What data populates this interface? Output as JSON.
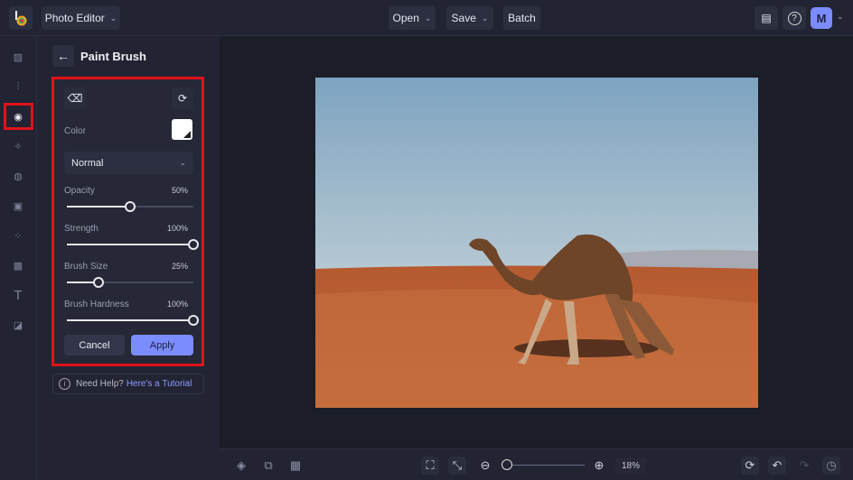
{
  "topbar": {
    "app_menu": "Photo Editor",
    "open": "Open",
    "save": "Save",
    "batch": "Batch",
    "avatar": "M"
  },
  "rail": {
    "icons": [
      "image-icon",
      "adjust-icon",
      "eye-icon",
      "effects-icon",
      "artsy-icon",
      "frames-icon",
      "graphics-icon",
      "texture-icon",
      "text-icon",
      "overlay-icon"
    ],
    "active": "eye-icon"
  },
  "panel": {
    "title": "Paint Brush",
    "color_label": "Color",
    "color_value": "#ffffff",
    "blend_mode": "Normal",
    "sliders": [
      {
        "label": "Opacity",
        "value": 50,
        "display": "50%"
      },
      {
        "label": "Strength",
        "value": 100,
        "display": "100%"
      },
      {
        "label": "Brush Size",
        "value": 25,
        "display": "25%"
      },
      {
        "label": "Brush Hardness",
        "value": 100,
        "display": "100%"
      }
    ],
    "cancel": "Cancel",
    "apply": "Apply",
    "help_text": "Need Help?",
    "help_link": "Here's a Tutorial"
  },
  "bottombar": {
    "zoom": "18%",
    "zoom_value": 18
  },
  "colors": {
    "accent": "#7b8cff",
    "highlight": "#e0121b"
  }
}
